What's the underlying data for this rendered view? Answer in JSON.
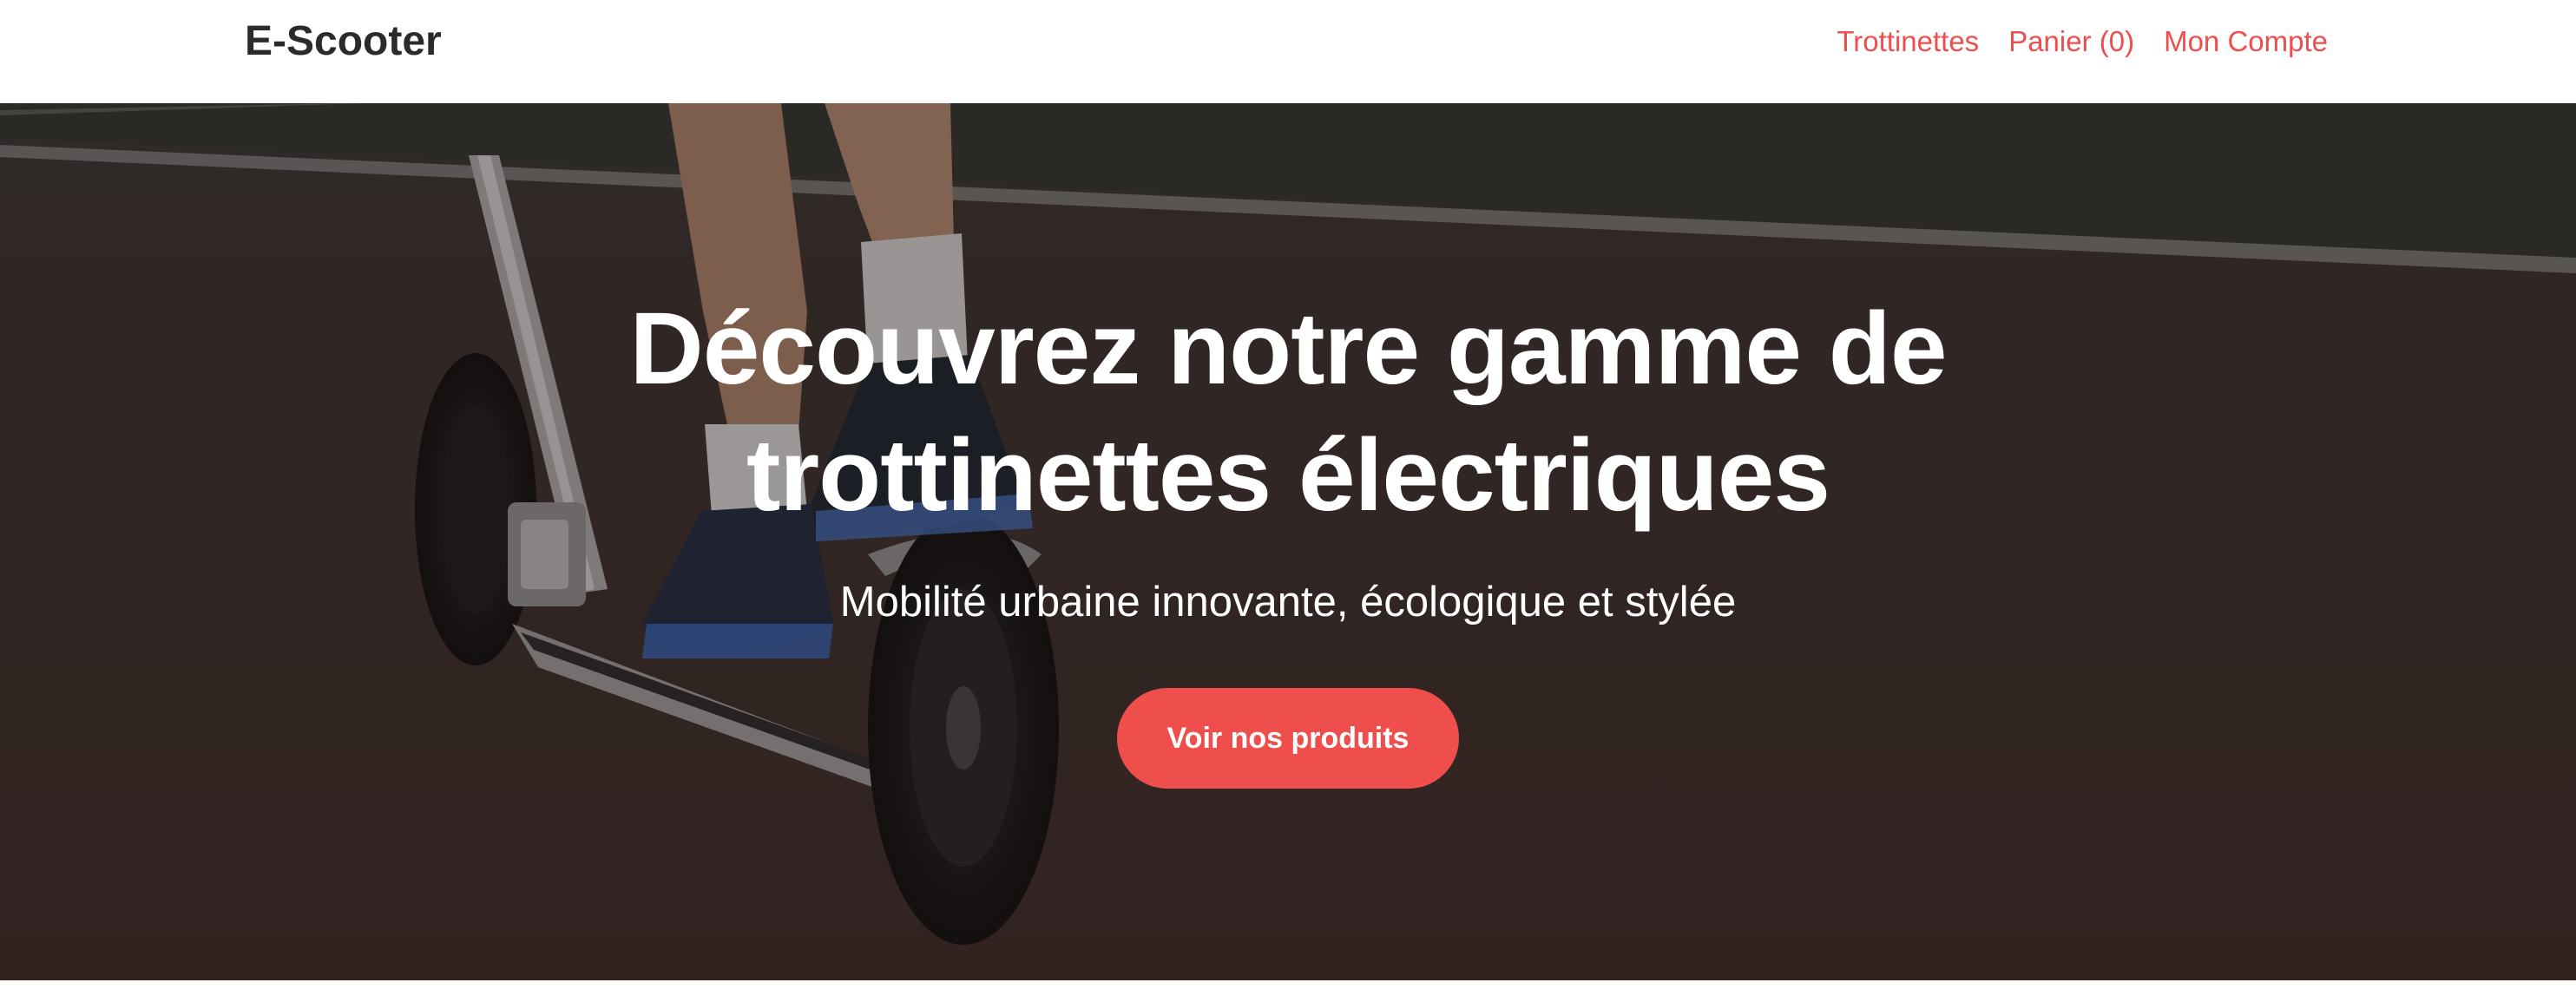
{
  "header": {
    "brand": "E-Scooter",
    "nav": [
      {
        "label": "Trottinettes"
      },
      {
        "label": "Panier (0)"
      },
      {
        "label": "Mon Compte"
      }
    ]
  },
  "hero": {
    "title": "Découvrez notre gamme de trottinettes électriques",
    "subtitle": "Mobilité urbaine innovante, écologique et stylée",
    "cta_label": "Voir nos produits",
    "background_image": "photo-of-person-riding-kick-scooter"
  },
  "colors": {
    "accent": "#ef4e4e",
    "brand_text": "#2b2b2b",
    "hero_overlay": "#2a211f"
  }
}
